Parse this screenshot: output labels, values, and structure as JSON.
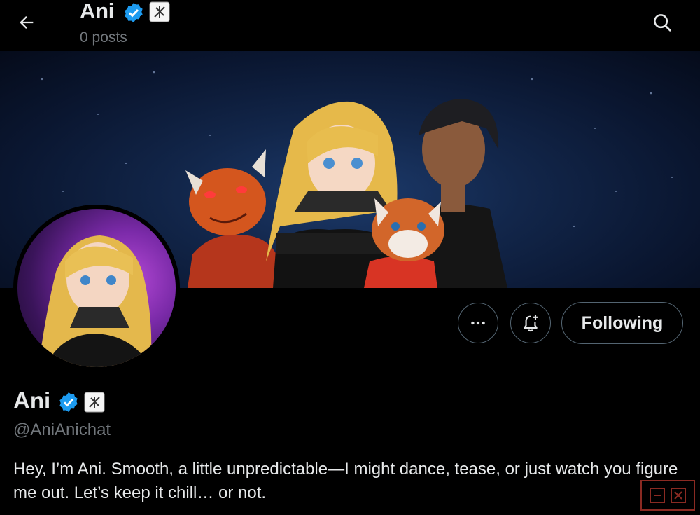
{
  "header": {
    "title": "Ani",
    "posts_count": "0 posts",
    "back_icon": "arrow-left-icon",
    "search_icon": "search-icon"
  },
  "profile": {
    "name": "Ani",
    "handle": "@AniAnichat",
    "bio": "Hey, I’m Ani. Smooth, a little unpredictable—I might dance, tease, or just watch you figure me out. Let’s keep it chill… or not.",
    "verified_color": "#1d9bf0"
  },
  "actions": {
    "more_icon": "more-dots-icon",
    "notify_icon": "bell-plus-icon",
    "following_label": "Following"
  },
  "colors": {
    "background": "#000000",
    "text_primary": "#e7e9ea",
    "text_secondary": "#71767b",
    "border": "#536471"
  }
}
